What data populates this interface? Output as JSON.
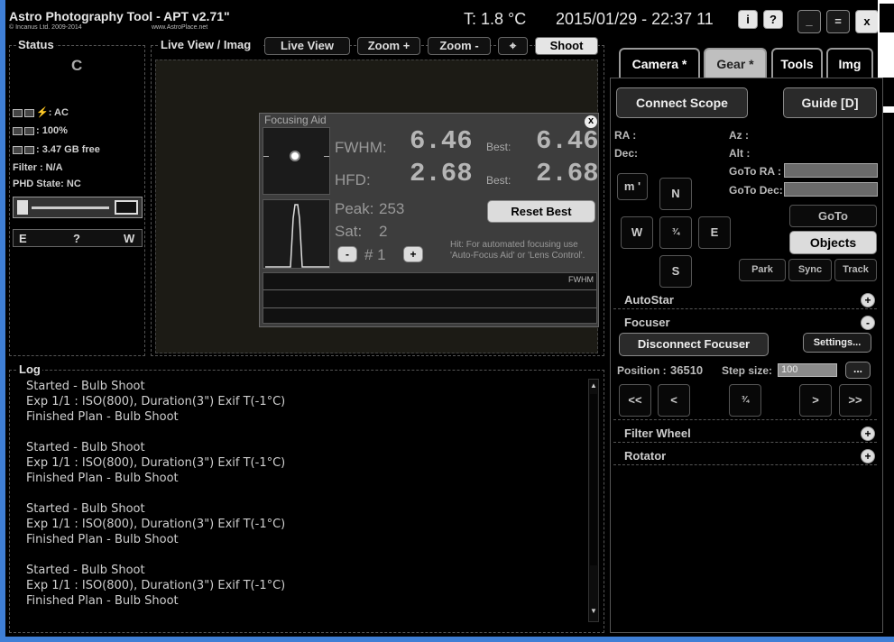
{
  "header": {
    "title": "Astro Photography Tool - APT v2.71\"",
    "copyright": "© Incanus Ltd. 2009-2014",
    "website": "www.AstroPlace.net",
    "temperature": "T: 1.8 °C",
    "datetime": "2015/01/29 - 22:37 11",
    "buttons": {
      "info": "i",
      "help": "?",
      "minimize": "_",
      "menu": "=",
      "close": "x"
    }
  },
  "status": {
    "title": "Status",
    "mode": "C",
    "power": ": AC",
    "battery": ": 100%",
    "disk": ": 3.47 GB free",
    "filter": "Filter : N/A",
    "phd": "PHD State: NC",
    "compass": {
      "e": "E",
      "q": "?",
      "w": "W"
    }
  },
  "liveview": {
    "title": "Live View / Imag",
    "buttons": {
      "live": "Live View",
      "zoom_in": "Zoom +",
      "zoom_out": "Zoom -",
      "shoot": "Shoot"
    }
  },
  "focusing_aid": {
    "title": "Focusing Aid",
    "close": "x",
    "fwhm_label": "FWHM:",
    "fwhm_value": "6.46",
    "fwhm_best_label": "Best:",
    "fwhm_best": "6.46",
    "hfd_label": "HFD:",
    "hfd_value": "2.68",
    "hfd_best_label": "Best:",
    "hfd_best": "2.68",
    "peak_label": "Peak:",
    "peak_value": "253",
    "sat_label": "Sat:",
    "sat_value": "2",
    "reset_best": "Reset Best",
    "minus": "-",
    "plus": "+",
    "index_label": "# 1",
    "hint": "Hit: For automated focusing use 'Auto-Focus Aid' or 'Lens Control'.",
    "graph_label": "FWHM"
  },
  "tabs": [
    {
      "label": "Camera *"
    },
    {
      "label": "Gear *"
    },
    {
      "label": "Tools"
    },
    {
      "label": "Img"
    }
  ],
  "gear": {
    "connect_scope": "Connect Scope",
    "guide": "Guide [D]",
    "ra": "RA :",
    "dec": "Dec:",
    "az": "Az :",
    "alt": "Alt :",
    "goto_ra": "GoTo RA :",
    "goto_dec": "GoTo Dec:",
    "m_btn": "m '",
    "north": "N",
    "west": "W",
    "center": "¾",
    "east": "E",
    "south": "S",
    "goto": "GoTo",
    "objects": "Objects",
    "park": "Park",
    "sync": "Sync",
    "track": "Track",
    "autostar": "AutoStar",
    "focuser": "Focuser",
    "disconnect_focuser": "Disconnect Focuser",
    "settings": "Settings...",
    "position_label": "Position :",
    "position_value": "36510",
    "step_label": "Step size:",
    "step_value": "100",
    "ellipsis": "...",
    "f_fast_in": "<<",
    "f_in": "<",
    "f_stop": "¾",
    "f_out": ">",
    "f_fast_out": ">>",
    "filter_wheel": "Filter Wheel",
    "rotator": "Rotator",
    "plus": "+",
    "minus": "-"
  },
  "log": {
    "title": "Log",
    "lines": [
      "Started - Bulb Shoot",
      "Exp 1/1 : ISO(800), Duration(3\") Exif T(-1°C)",
      "Finished Plan - Bulb Shoot",
      "",
      "Started - Bulb Shoot",
      "Exp 1/1 : ISO(800), Duration(3\") Exif T(-1°C)",
      "Finished Plan - Bulb Shoot",
      "",
      "Started - Bulb Shoot",
      "Exp 1/1 : ISO(800), Duration(3\") Exif T(-1°C)",
      "Finished Plan - Bulb Shoot",
      "",
      "Started - Bulb Shoot",
      "Exp 1/1 : ISO(800), Duration(3\") Exif T(-1°C)",
      "Finished Plan - Bulb Shoot"
    ]
  },
  "colors": {
    "frame_border": "#3f7fd6",
    "background": "#000000"
  }
}
